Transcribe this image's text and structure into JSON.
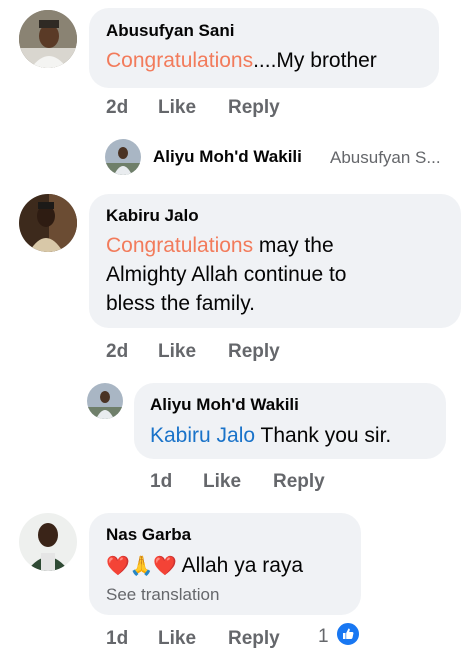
{
  "comments": [
    {
      "author": "Abusufyan Sani",
      "highlight": "Congratulations",
      "text": "....My brother",
      "time": "2d",
      "like": "Like",
      "reply": "Reply"
    },
    {
      "collapsed_reply": {
        "author": "Aliyu Moh'd Wakili",
        "preview": "Abusufyan S..."
      }
    },
    {
      "author": "Kabiru Jalo",
      "highlight": "Congratulations",
      "text_line1": " may the",
      "text_line2": "Almighty Allah continue to",
      "text_line3": "bless the family.",
      "time": "2d",
      "like": "Like",
      "reply": "Reply"
    },
    {
      "author": "Aliyu Moh'd Wakili",
      "mention": "Kabiru Jalo",
      "text": " Thank you sir.",
      "time": "1d",
      "like": "Like",
      "reply": "Reply"
    },
    {
      "author": "Nas Garba",
      "emoji": "❤️🙏❤️",
      "text": " Allah ya raya",
      "see_translation": "See translation",
      "time": "1d",
      "like": "Like",
      "reply": "Reply",
      "reaction_count": "1"
    }
  ],
  "colors": {
    "bubble": "#f0f2f5",
    "highlight": "#f27b5b",
    "mention": "#1a73c9",
    "meta": "#65676b",
    "like_badge": "#1877f2"
  }
}
